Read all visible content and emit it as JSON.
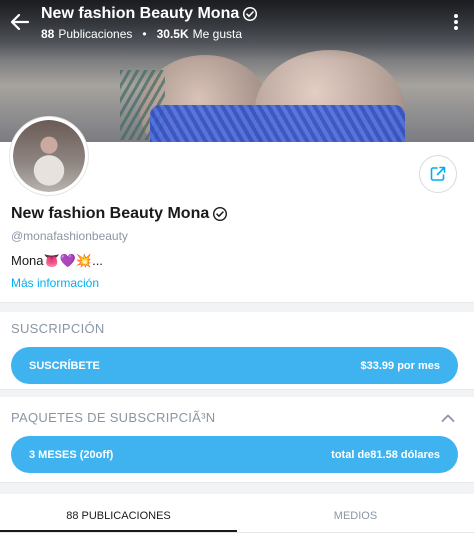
{
  "header": {
    "title": "New fashion Beauty Mona",
    "posts_count": "88",
    "posts_label": "Publicaciones",
    "likes_count": "30.5K",
    "likes_label": "Me gusta",
    "separator": "•"
  },
  "profile": {
    "name": "New fashion Beauty Mona",
    "handle": "@monafashionbeauty",
    "bio": "Mona👅💜💥...",
    "more_info": "Más información"
  },
  "subscription": {
    "section_label": "SUSCRIPCIÓN",
    "subscribe_label": "SUSCRÍBETE",
    "price": "$33.99 por mes"
  },
  "bundles": {
    "section_label": "PAQUETES DE SUBSCRIPCIÃ³N",
    "bundle_label": "3 MESES (20off)",
    "bundle_price": "total de81.58 dólares"
  },
  "tabs": [
    {
      "label": "88 PUBLICACIONES",
      "active": true
    },
    {
      "label": "MEDIOS",
      "active": false
    }
  ],
  "colors": {
    "accent": "#3fb3ef",
    "link": "#00aff0",
    "muted": "#8a96a3"
  },
  "icons": {
    "back": "arrow-left-icon",
    "verified": "verified-badge-icon",
    "more": "more-vertical-icon",
    "share": "share-icon",
    "collapse": "chevron-up-icon"
  }
}
